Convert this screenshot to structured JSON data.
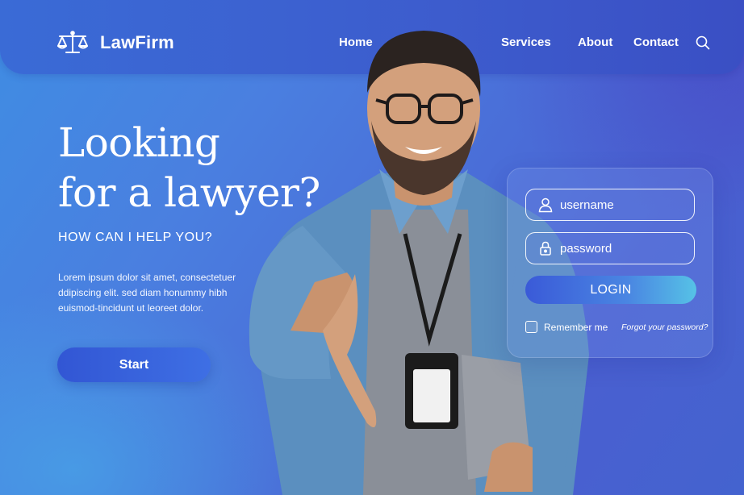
{
  "brand": {
    "name": "LawFirm",
    "icon": "scales-icon"
  },
  "nav": {
    "items": [
      {
        "label": "Home"
      },
      {
        "label": "Services"
      },
      {
        "label": "About"
      },
      {
        "label": "Contact"
      }
    ],
    "search_icon": "search-icon"
  },
  "hero": {
    "title_line1": "Looking",
    "title_line2": "for a lawyer?",
    "subtitle": "HOW CAN I HELP YOU?",
    "body": "Lorem ipsum dolor sit amet, consectetuer ddipiscing elit. sed diam honummy hibh euismod-tincidunt ut leoreet dolor.",
    "start_label": "Start"
  },
  "login": {
    "username_placeholder": "username",
    "password_placeholder": "password",
    "login_label": "LOGIN",
    "remember_label": "Remember me",
    "forgot_label": "Forgot your password?"
  },
  "colors": {
    "background": "#4a7fe0",
    "header": "#3d5ccd",
    "button": "#3256d4",
    "login_gradient_end": "#56c2e6"
  }
}
